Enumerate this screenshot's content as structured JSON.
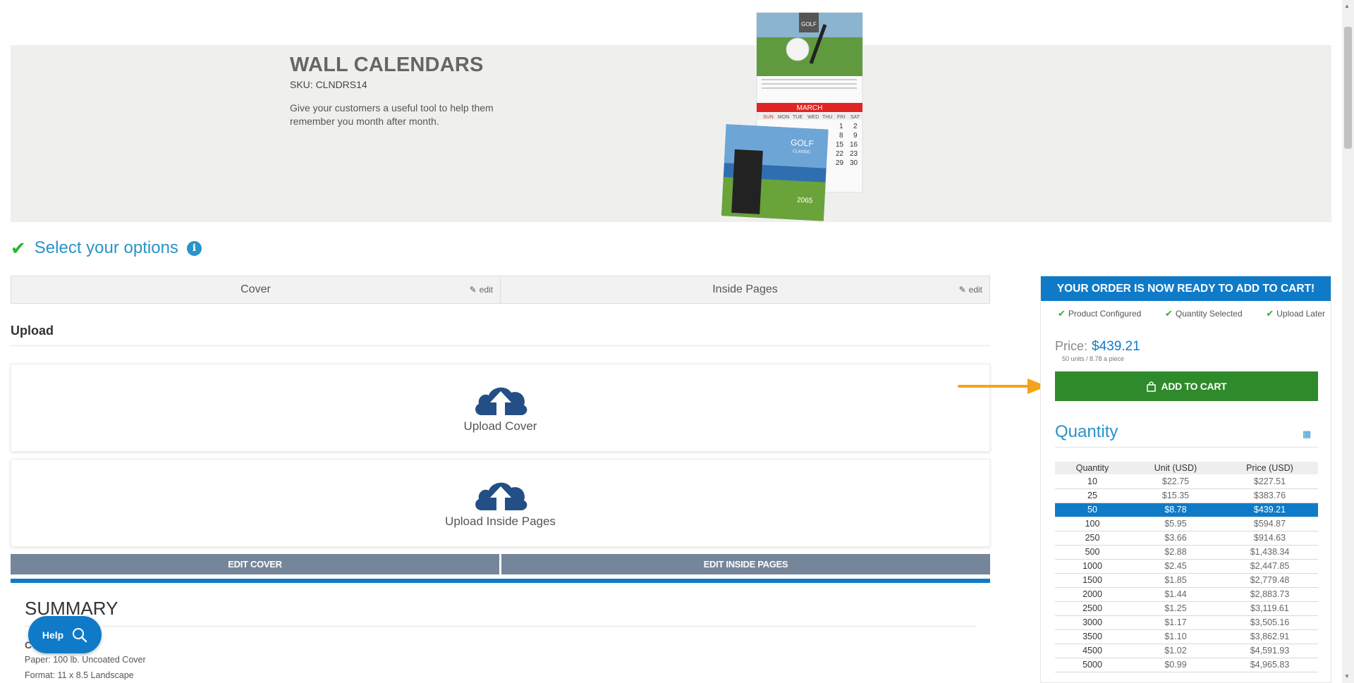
{
  "hero": {
    "title": "WALL CALENDARS",
    "sku": "SKU: CLNDRS14",
    "description": "Give your customers a useful tool to help them remember you month after month.",
    "calendar_month": "MARCH",
    "calendar_brand": "GOLF",
    "calendar_brand_sub": "CLASSIC",
    "calendar_year": "2065",
    "calendar_days": [
      "SUN",
      "MON",
      "TUE",
      "WED",
      "THU",
      "FRI",
      "SAT"
    ],
    "calendar_numbers": [
      "1",
      "2",
      "8",
      "9",
      "15",
      "16",
      "22",
      "23",
      "29",
      "30"
    ]
  },
  "options": {
    "title": "Select your options",
    "info_icon": "i",
    "tabs": [
      {
        "label": "Cover",
        "edit": "edit"
      },
      {
        "label": "Inside Pages",
        "edit": "edit"
      }
    ]
  },
  "upload": {
    "heading": "Upload",
    "cover_label": "Upload Cover",
    "inside_label": "Upload Inside Pages"
  },
  "edit_buttons": {
    "cover": "EDIT COVER",
    "inside": "EDIT INSIDE PAGES"
  },
  "summary": {
    "title": "SUMMARY",
    "lines": [
      "C",
      "Paper: 100 lb. Uncoated Cover",
      "Format: 11 x 8.5 Landscape"
    ]
  },
  "help": {
    "label": "Help"
  },
  "panel": {
    "banner": "YOUR ORDER IS NOW READY TO ADD TO CART!",
    "status": [
      "Product Configured",
      "Quantity Selected",
      "Upload Later"
    ],
    "price_label": "Price:",
    "price_value": "$439.21",
    "price_sub": "50 units / 8.78 a piece",
    "cart_label": "ADD TO CART",
    "qty_title": "Quantity",
    "table_headers": [
      "Quantity",
      "Unit (USD)",
      "Price (USD)"
    ],
    "rows": [
      [
        "10",
        "$22.75",
        "$227.51"
      ],
      [
        "25",
        "$15.35",
        "$383.76"
      ],
      [
        "50",
        "$8.78",
        "$439.21"
      ],
      [
        "100",
        "$5.95",
        "$594.87"
      ],
      [
        "250",
        "$3.66",
        "$914.63"
      ],
      [
        "500",
        "$2.88",
        "$1,438.34"
      ],
      [
        "1000",
        "$2.45",
        "$2,447.85"
      ],
      [
        "1500",
        "$1.85",
        "$2,779.48"
      ],
      [
        "2000",
        "$1.44",
        "$2,883.73"
      ],
      [
        "2500",
        "$1.25",
        "$3,119.61"
      ],
      [
        "3000",
        "$1.17",
        "$3,505.16"
      ],
      [
        "3500",
        "$1.10",
        "$3,862.91"
      ],
      [
        "4500",
        "$1.02",
        "$4,591.93"
      ],
      [
        "5000",
        "$0.99",
        "$4,965.83"
      ]
    ],
    "selected_quantity": "50"
  },
  "colors": {
    "brand_blue": "#0f7bc8",
    "cart_green": "#2f8a2b",
    "check_green": "#2db52d",
    "arrow_orange": "#f5a31a",
    "edit_button_gray": "#76869a"
  }
}
